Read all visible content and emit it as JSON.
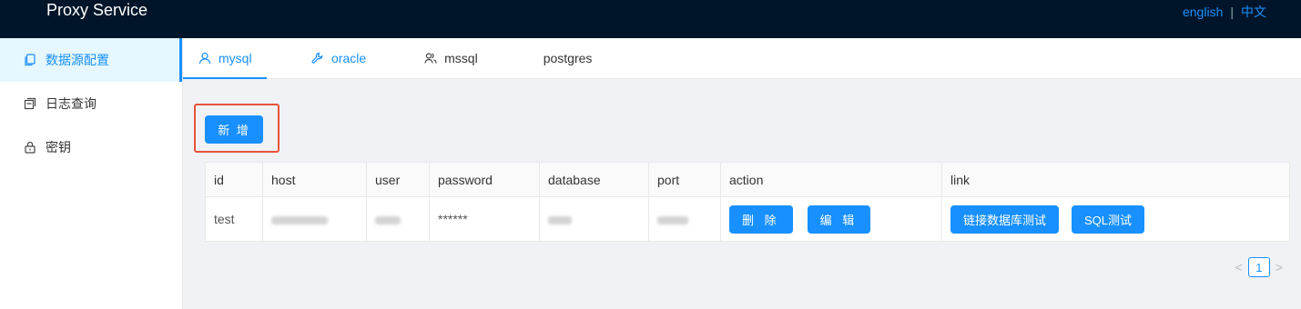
{
  "header": {
    "title": "Proxy Service",
    "lang_english": "english",
    "lang_separator": "|",
    "lang_chinese": "中文"
  },
  "sidebar": {
    "items": [
      {
        "label": "数据源配置",
        "icon": "copy-icon",
        "active": true
      },
      {
        "label": "日志查询",
        "icon": "switcher-icon",
        "active": false
      },
      {
        "label": "密钥",
        "icon": "lock-icon",
        "active": false
      }
    ]
  },
  "tabs": [
    {
      "label": "mysql",
      "icon": "user-icon",
      "active": true
    },
    {
      "label": "oracle",
      "icon": "tool-icon",
      "active": false
    },
    {
      "label": "mssql",
      "icon": "team-icon",
      "active": false
    },
    {
      "label": "postgres",
      "icon": "",
      "active": false
    }
  ],
  "toolbar": {
    "add_label": "新 增"
  },
  "table": {
    "columns": [
      "id",
      "host",
      "user",
      "password",
      "database",
      "port",
      "action",
      "link"
    ],
    "rows": [
      {
        "id": "test",
        "password": "******",
        "delete_label": "删 除",
        "edit_label": "编 辑",
        "link_test_label": "链接数据库测试",
        "sql_test_label": "SQL测试"
      }
    ]
  },
  "pagination": {
    "prev": "<",
    "current": "1",
    "next": ">"
  },
  "colors": {
    "header_bg": "#001529",
    "accent": "#1890ff",
    "highlight_border": "#e8533a",
    "content_bg": "#f0f2f5"
  }
}
